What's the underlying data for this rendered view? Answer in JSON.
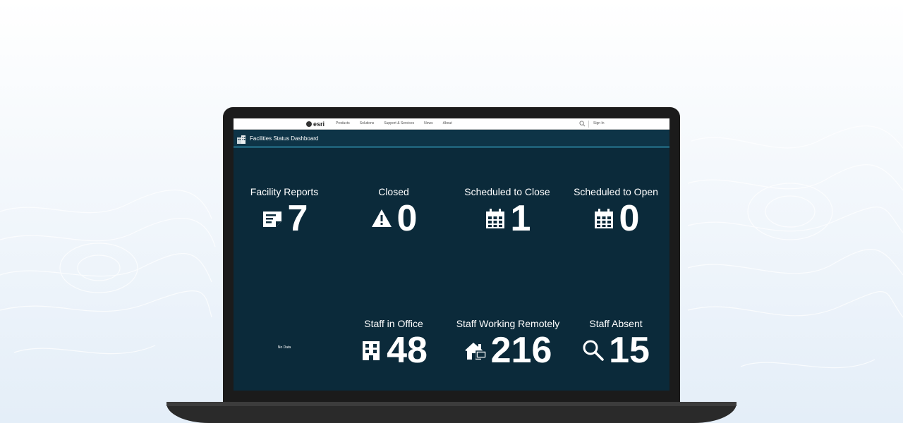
{
  "colors": {
    "screen_bg": "#0b2a3a",
    "header_bg": "#0e3447",
    "header_accent": "#1e5e76",
    "text": "#ffffff"
  },
  "esri_bar": {
    "logo_text": "esri",
    "nav": [
      "Products",
      "Solutions",
      "Support & Services",
      "News",
      "About"
    ],
    "sign_in": "Sign In"
  },
  "dashboard": {
    "title": "Facilities Status Dashboard",
    "no_data": "No Data",
    "indicators": [
      {
        "title": "Facility Reports",
        "value": "7",
        "icon": "report-icon"
      },
      {
        "title": "Closed",
        "value": "0",
        "icon": "warning-icon"
      },
      {
        "title": "Scheduled to Close",
        "value": "1",
        "icon": "calendar-icon"
      },
      {
        "title": "Scheduled to Open",
        "value": "0",
        "icon": "calendar-icon"
      },
      {
        "title": "Staff in Office",
        "value": "48",
        "icon": "building-icon"
      },
      {
        "title": "Staff Working Remotely",
        "value": "216",
        "icon": "home-icon"
      },
      {
        "title": "Staff Absent",
        "value": "15",
        "icon": "search-icon"
      }
    ]
  }
}
